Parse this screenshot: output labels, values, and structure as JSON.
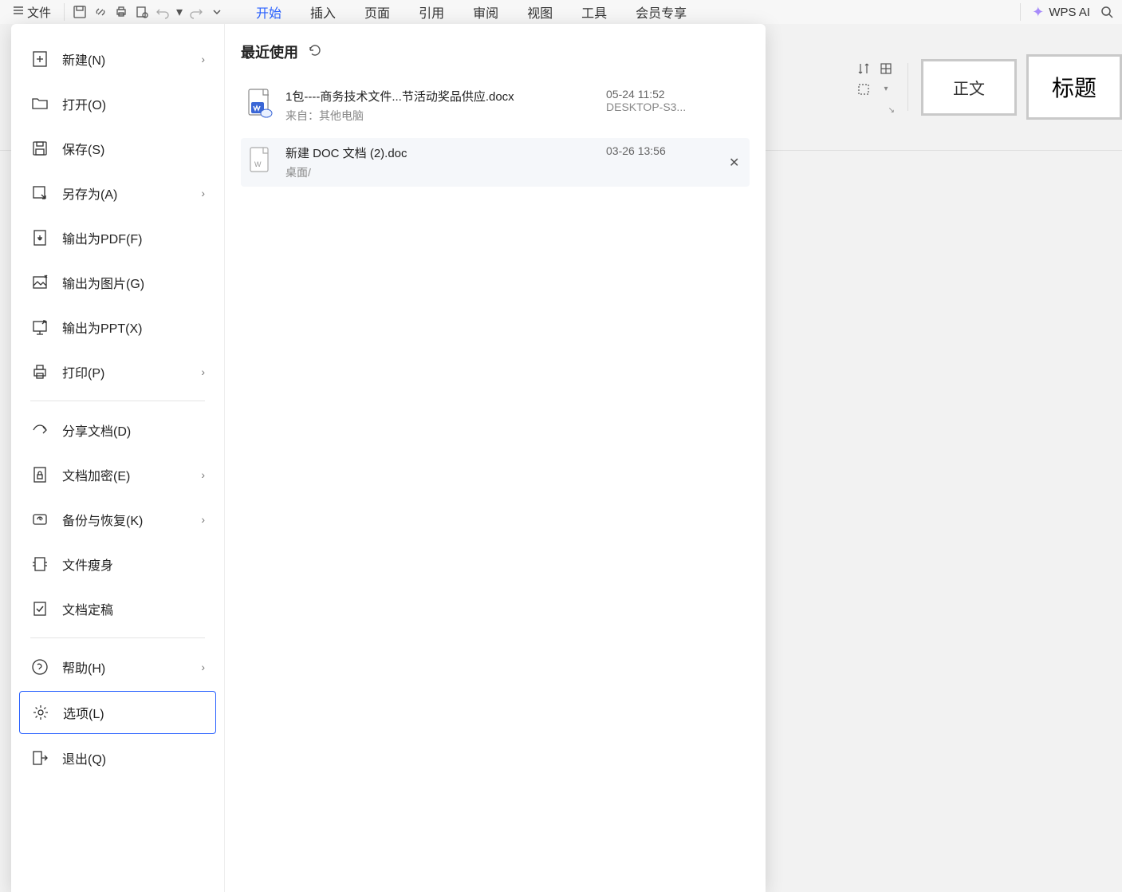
{
  "topbar": {
    "file_label": "文件",
    "tabs": [
      "开始",
      "插入",
      "页面",
      "引用",
      "审阅",
      "视图",
      "工具",
      "会员专享"
    ],
    "active_tab_index": 0,
    "wps_ai": "WPS AI"
  },
  "right_panel": {
    "style_normal": "正文",
    "style_heading": "标题"
  },
  "file_menu": {
    "items": [
      {
        "label": "新建(N)",
        "has_chevron": true
      },
      {
        "label": "打开(O)"
      },
      {
        "label": "保存(S)"
      },
      {
        "label": "另存为(A)",
        "has_chevron": true
      },
      {
        "label": "输出为PDF(F)"
      },
      {
        "label": "输出为图片(G)"
      },
      {
        "label": "输出为PPT(X)"
      },
      {
        "label": "打印(P)",
        "has_chevron": true
      },
      {
        "divider": true
      },
      {
        "label": "分享文档(D)"
      },
      {
        "label": "文档加密(E)",
        "has_chevron": true
      },
      {
        "label": "备份与恢复(K)",
        "has_chevron": true
      },
      {
        "label": "文件瘦身"
      },
      {
        "label": "文档定稿"
      },
      {
        "divider": true
      },
      {
        "label": "帮助(H)",
        "has_chevron": true
      },
      {
        "label": "选项(L)",
        "selected": true
      },
      {
        "label": "退出(Q)"
      }
    ]
  },
  "recent": {
    "heading": "最近使用",
    "files": [
      {
        "name": "1包----商务技术文件...节活动奖品供应.docx",
        "sub_prefix": "来自：",
        "sub": "其他电脑",
        "time": "05-24 11:52",
        "device": "DESKTOP-S3...",
        "icon": "docx-cloud"
      },
      {
        "name": "新建 DOC 文档 (2).doc",
        "sub": "桌面/",
        "time": "03-26 13:56",
        "device": "",
        "icon": "doc",
        "show_close": true
      }
    ]
  }
}
